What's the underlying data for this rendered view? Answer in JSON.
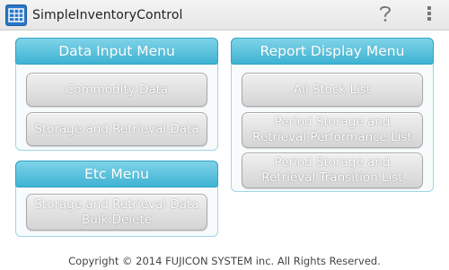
{
  "app": {
    "title": "SimpleInventoryControl",
    "icon": "app-logo-icon",
    "help_icon": "question-mark-icon",
    "overflow_icon": "overflow-menu-icon",
    "accent_color": "#3eb3d3"
  },
  "data_input_menu": {
    "title": "Data Input Menu",
    "buttons": [
      "Commodity Data",
      "Storage and Retrieval Data"
    ]
  },
  "etc_menu": {
    "title": "Etc Menu",
    "buttons": [
      "Storage and Retrieval Data Bulk Delete"
    ]
  },
  "report_display_menu": {
    "title": "Report Display Menu",
    "buttons": [
      "All Stock List",
      "Period Storage and Retrieval Performance List",
      "Period Storage and Retrieval Transition List"
    ]
  },
  "footer": {
    "copyright": "Copyright © 2014 FUJICON SYSTEM inc. All Rights Reserved."
  }
}
